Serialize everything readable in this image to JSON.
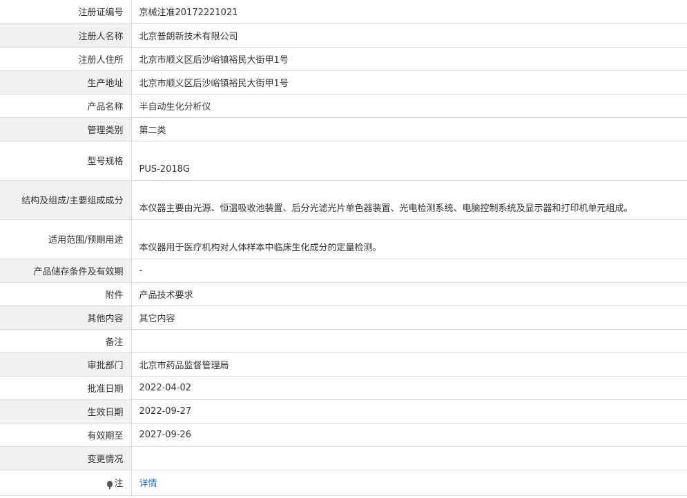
{
  "rows": [
    {
      "label": "注册证编号",
      "value": "京械注准20172221021"
    },
    {
      "label": "注册人名称",
      "value": "北京普朗新技术有限公司"
    },
    {
      "label": "注册人住所",
      "value": "北京市顺义区后沙峪镇裕民大街甲1号"
    },
    {
      "label": "生产地址",
      "value": "北京市顺义区后沙峪镇裕民大街甲1号"
    },
    {
      "label": "产品名称",
      "value": "半自动生化分析仪"
    },
    {
      "label": "管理类别",
      "value": "第二类"
    },
    {
      "label": "型号规格",
      "value": "PUS-2018G"
    },
    {
      "label": "结构及组成/主要组成成分",
      "value": "本仪器主要由光源、恒温吸收池装置、后分光滤光片单色器装置、光电检测系统、电脑控制系统及显示器和打印机单元组成。"
    },
    {
      "label": "适用范围/预期用途",
      "value": "本仪器用于医疗机构对人体样本中临床生化成分的定量检测。"
    },
    {
      "label": "产品储存条件及有效期",
      "value": "-"
    },
    {
      "label": "附件",
      "value": "产品技术要求"
    },
    {
      "label": "其他内容",
      "value": "其它内容"
    },
    {
      "label": "备注",
      "value": ""
    },
    {
      "label": "审批部门",
      "value": "北京市药品监督管理局"
    },
    {
      "label": "批准日期",
      "value": "2022-04-02"
    },
    {
      "label": "生效日期",
      "value": "2022-09-27"
    },
    {
      "label": "有效期至",
      "value": "2027-09-26"
    },
    {
      "label": "变更情况",
      "value": ""
    },
    {
      "label": "注",
      "value": "详情",
      "icon": "lightbulb-icon"
    }
  ]
}
